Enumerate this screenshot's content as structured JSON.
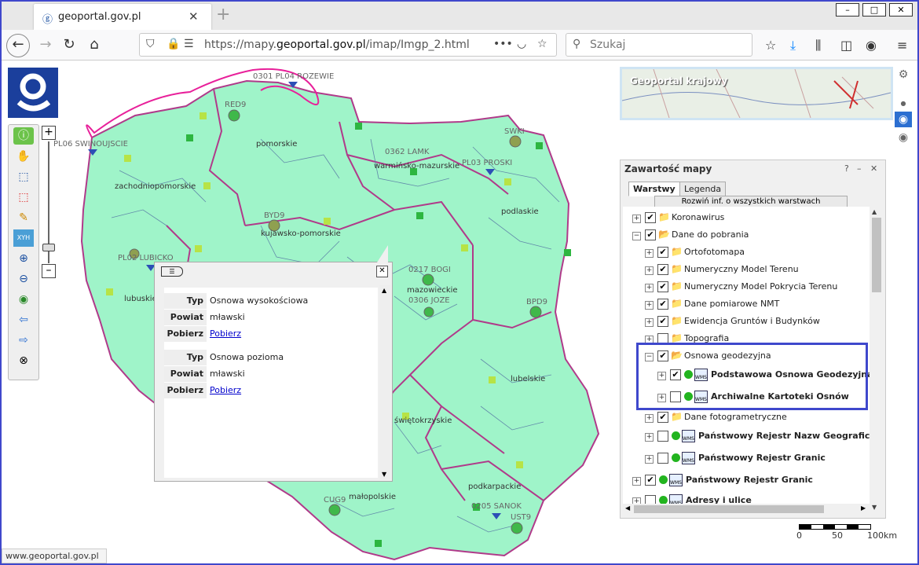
{
  "browser": {
    "tab_title": "geoportal.gov.pl",
    "new_tab": "+",
    "url_prefix": "https://mapy.",
    "url_domain": "geoportal.gov.pl",
    "url_suffix": "/imap/Imgp_2.html",
    "search_placeholder": "Szukaj",
    "status_url": "www.geoportal.gov.pl"
  },
  "minimap": {
    "label": "Geoportal krajowy"
  },
  "panel": {
    "title": "Zawartość mapy",
    "tabs": [
      {
        "label": "Warstwy"
      },
      {
        "label": "Legenda"
      }
    ],
    "expand_all": "Rozwiń inf. o wszystkich warstwach"
  },
  "layers": [
    {
      "label": "Koronawirus"
    },
    {
      "label": "Dane do pobrania"
    },
    {
      "label": "Ortofotomapa"
    },
    {
      "label": "Numeryczny Model Terenu"
    },
    {
      "label": "Numeryczny Model Pokrycia Terenu"
    },
    {
      "label": "Dane pomiarowe NMT"
    },
    {
      "label": "Ewidencja Gruntów i Budynków"
    },
    {
      "label": "Topografia"
    },
    {
      "label": "Osnowa geodezyjna"
    },
    {
      "label": "Podstawowa Osnowa Geodezyjna"
    },
    {
      "label": "Archiwalne Kartoteki Osnów"
    },
    {
      "label": "Dane fotogrametryczne"
    },
    {
      "label": "Państwowy Rejestr Nazw Geograficznych"
    },
    {
      "label": "Państwowy Rejestr Granic"
    },
    {
      "label": "Państwowy Rejestr Granic"
    },
    {
      "label": "Adresy i ulice"
    }
  ],
  "popup": {
    "records": [
      {
        "typ_key": "Typ",
        "typ": "Osnowa wysokościowa",
        "powiat_key": "Powiat",
        "powiat": "mławski",
        "pobierz_key": "Pobierz",
        "pobierz": "Pobierz"
      },
      {
        "typ_key": "Typ",
        "typ": "Osnowa pozioma",
        "powiat_key": "Powiat",
        "powiat": "mławski",
        "pobierz_key": "Pobierz",
        "pobierz": "Pobierz"
      }
    ]
  },
  "map_labels": {
    "pomorskie": "pomorskie",
    "zachodniopomorskie": "zachodniopomorskie",
    "warminsko": "warmińsko-mazurskie",
    "podlaskie": "podlaskie",
    "kujawsko": "kujawsko-pomorskie",
    "lubuskie": "lubuskie",
    "mazowieckie": "mazowieckie",
    "lubelskie": "lubelskie",
    "swietokrzyskie": "świętokrzyskie",
    "malopolskie": "małopolskie",
    "podkarpackie": "podkarpackie",
    "st1": "0301 PL04 ROZEWIE",
    "st2": "PL06 SWINOUJSCIE",
    "st3": "RED9",
    "st4": "0362 LAMK",
    "st5": "SWKI",
    "st6": "PL03 PROSKI",
    "st7": "BYD9",
    "st8": "PL02 LUBICKO",
    "st9": "0217 BOGI",
    "st10": "0306 JOZE",
    "st11": "BPD9",
    "st12": "0205 SANOK",
    "st13": "CUG9",
    "st14": "UST9"
  },
  "scale": {
    "t0": "0",
    "t1": "50",
    "t2": "100km"
  }
}
